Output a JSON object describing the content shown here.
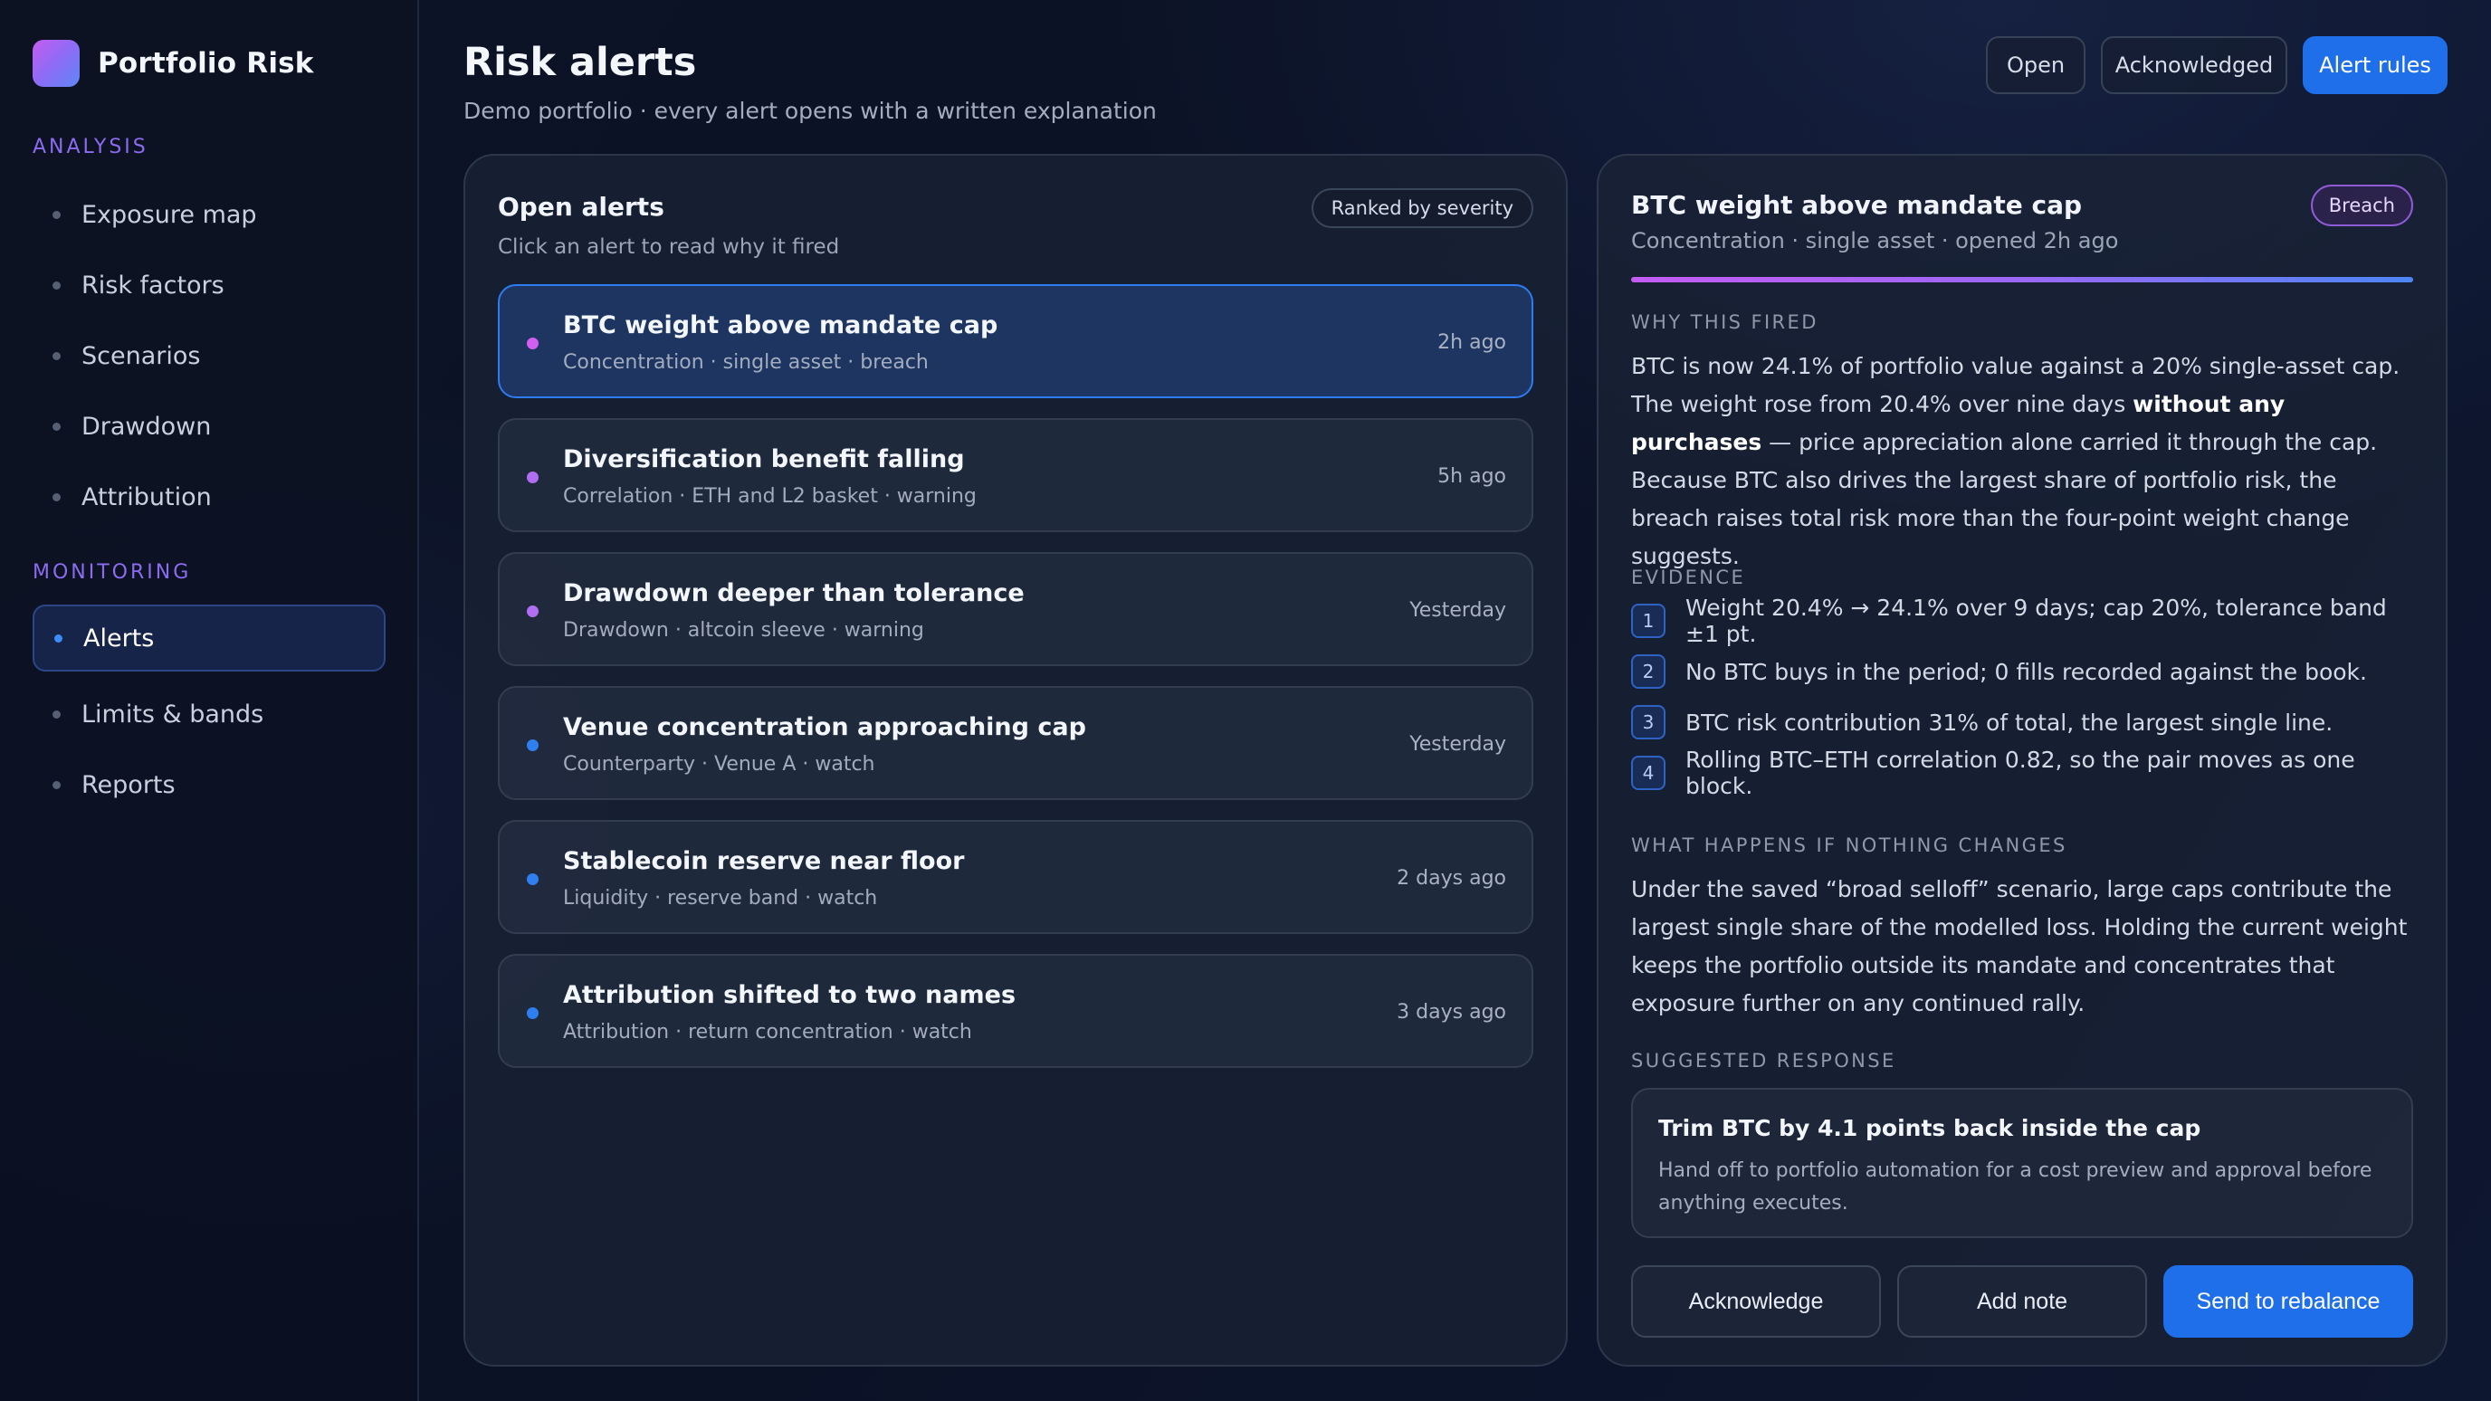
{
  "app": {
    "name": "Portfolio Risk"
  },
  "sidebar": {
    "analysis_label": "ANALYSIS",
    "analysis_items": [
      {
        "label": "Exposure map"
      },
      {
        "label": "Risk factors"
      },
      {
        "label": "Scenarios"
      },
      {
        "label": "Drawdown"
      },
      {
        "label": "Attribution"
      }
    ],
    "monitoring_label": "MONITORING",
    "monitoring_items": [
      {
        "label": "Alerts",
        "active": true
      },
      {
        "label": "Limits & bands"
      },
      {
        "label": "Reports"
      }
    ]
  },
  "header": {
    "title": "Risk alerts",
    "subtitle": "Demo portfolio · every alert opens with a written explanation",
    "buttons": {
      "open": "Open",
      "acknowledged": "Acknowledged",
      "alert_rules": "Alert rules"
    }
  },
  "alerts_panel": {
    "title": "Open alerts",
    "subtitle": "Click an alert to read why it fired",
    "sort_label": "Ranked by severity",
    "alerts": [
      {
        "title": "BTC weight above mandate cap",
        "meta": "Concentration · single asset · breach",
        "time": "2h ago",
        "dot_color": "#d35ff0"
      },
      {
        "title": "Diversification benefit falling",
        "meta": "Correlation · ETH and L2 basket · warning",
        "time": "5h ago",
        "dot_color": "#b06ef2"
      },
      {
        "title": "Drawdown deeper than tolerance",
        "meta": "Drawdown · altcoin sleeve · warning",
        "time": "Yesterday",
        "dot_color": "#b06ef2"
      },
      {
        "title": "Venue concentration approaching cap",
        "meta": "Counterparty · Venue A · watch",
        "time": "Yesterday",
        "dot_color": "#2f7ff0"
      },
      {
        "title": "Stablecoin reserve near floor",
        "meta": "Liquidity · reserve band · watch",
        "time": "2 days ago",
        "dot_color": "#2f7ff0"
      },
      {
        "title": "Attribution shifted to two names",
        "meta": "Attribution · return concentration · watch",
        "time": "3 days ago",
        "dot_color": "#2f7ff0"
      }
    ]
  },
  "detail": {
    "title": "BTC weight above mandate cap",
    "subtitle": "Concentration · single asset · opened 2h ago",
    "badge": "Breach",
    "why_label": "WHY THIS FIRED",
    "why_text_1": "BTC is now 24.1% of portfolio value against a 20% single-asset cap. The weight rose from 20.4% over nine days ",
    "why_text_bold": "without any purchases",
    "why_text_2": " — price appreciation alone carried it through the cap. Because BTC also drives the largest share of portfolio risk, the breach raises total risk more than the four-point weight change suggests.",
    "evidence_label": "EVIDENCE",
    "evidence": [
      {
        "num": "1",
        "text": "Weight 20.4% → 24.1% over 9 days; cap 20%, tolerance band ±1 pt."
      },
      {
        "num": "2",
        "text": "No BTC buys in the period; 0 fills recorded against the book."
      },
      {
        "num": "3",
        "text": "BTC risk contribution 31% of total, the largest single line."
      },
      {
        "num": "4",
        "text": "Rolling BTC–ETH correlation 0.82, so the pair moves as one block."
      }
    ],
    "nothing_label": "WHAT HAPPENS IF NOTHING CHANGES",
    "nothing_text": "Under the saved “broad selloff” scenario, large caps contribute the largest single share of the modelled loss. Holding the current weight keeps the portfolio outside its mandate and concentrates that exposure further on any continued rally.",
    "suggest_label": "SUGGESTED RESPONSE",
    "suggest_title": "Trim BTC by 4.1 points back inside the cap",
    "suggest_desc": "Hand off to portfolio automation for a cost preview and approval before anything executes.",
    "actions": {
      "acknowledge": "Acknowledge",
      "add_note": "Add note",
      "send": "Send to rebalance"
    }
  }
}
